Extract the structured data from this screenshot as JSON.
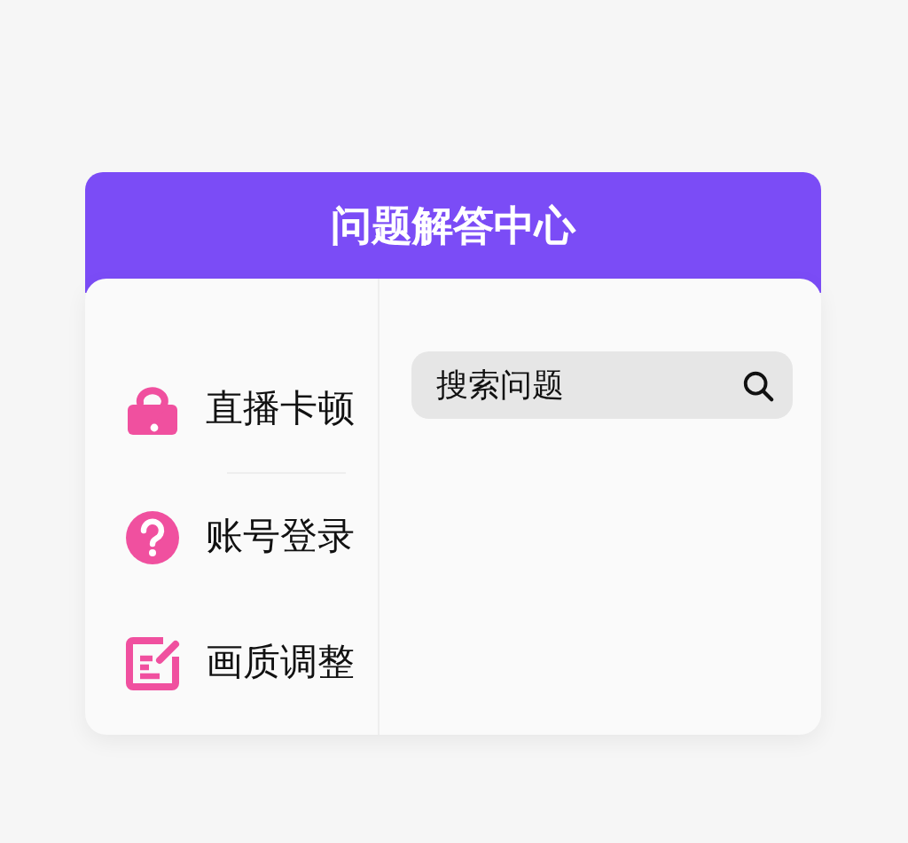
{
  "header": {
    "title": "问题解答中心"
  },
  "topics": [
    {
      "label": "直播卡顿",
      "kind": "lock"
    },
    {
      "label": "账号登录",
      "kind": "question"
    },
    {
      "label": "画质调整",
      "kind": "edit"
    }
  ],
  "search": {
    "placeholder": "搜索问题"
  }
}
